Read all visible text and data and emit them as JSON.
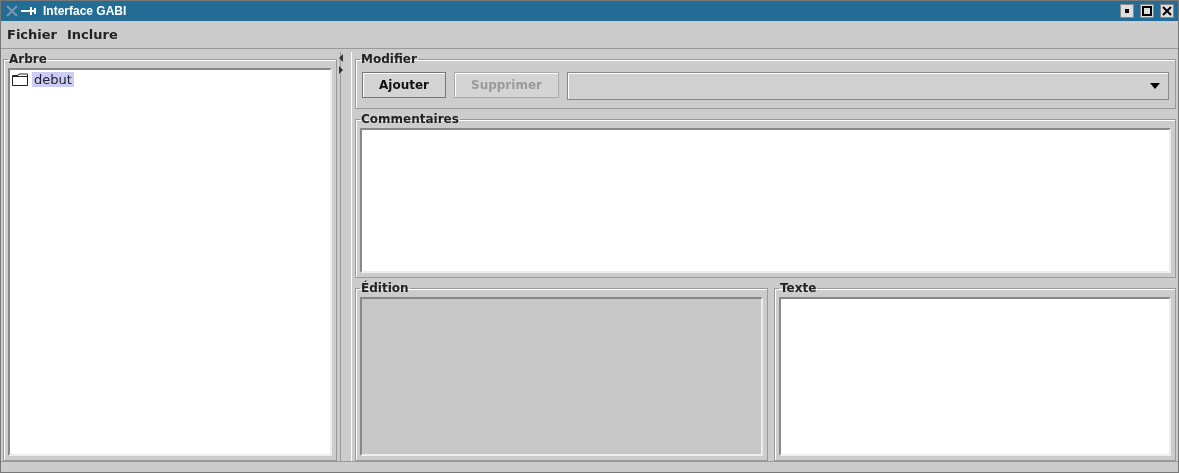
{
  "window": {
    "title": "Interface GABI"
  },
  "menu": [
    "Fichier",
    "Inclure"
  ],
  "tree": {
    "title": "Arbre",
    "items": [
      {
        "label": "debut",
        "selected": true
      }
    ]
  },
  "modifier": {
    "title": "Modifier",
    "buttons": [
      {
        "label": "Ajouter",
        "disabled": false
      },
      {
        "label": "Supprimer",
        "disabled": true
      }
    ]
  },
  "commentaires": {
    "title": "Commentaires"
  },
  "edition": {
    "title": "Édition"
  },
  "texte": {
    "title": "Texte"
  }
}
